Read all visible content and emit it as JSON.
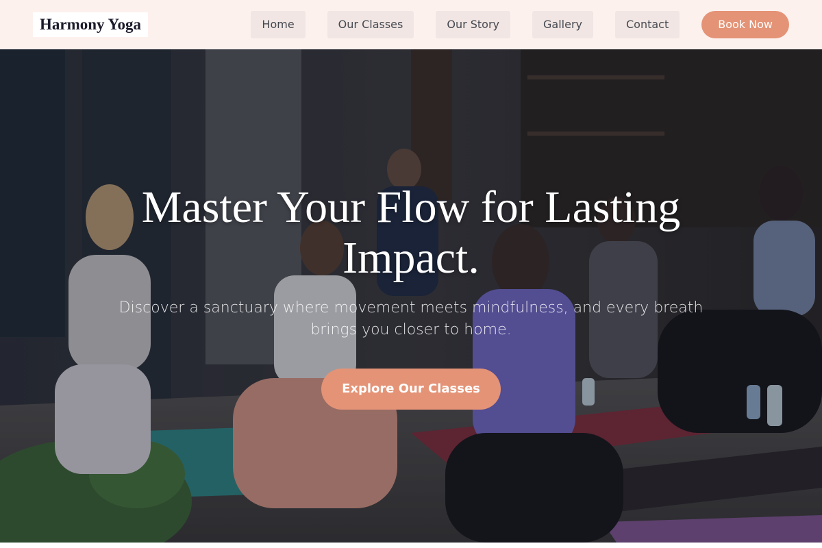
{
  "header": {
    "brand": "Harmony Yoga",
    "nav": [
      {
        "label": "Home"
      },
      {
        "label": "Our Classes"
      },
      {
        "label": "Our Story"
      },
      {
        "label": "Gallery"
      },
      {
        "label": "Contact"
      }
    ],
    "cta_label": "Book Now"
  },
  "hero": {
    "title": "Master Your Flow for Lasting Impact.",
    "subtitle": "Discover a sanctuary where movement meets mindfulness, and every breath brings you closer to home.",
    "cta_label": "Explore Our Classes"
  },
  "colors": {
    "header_bg": "#fdf1ee",
    "nav_item_bg": "#f1e6e3",
    "accent": "#e49376",
    "text_dark": "#1b1b2b"
  }
}
